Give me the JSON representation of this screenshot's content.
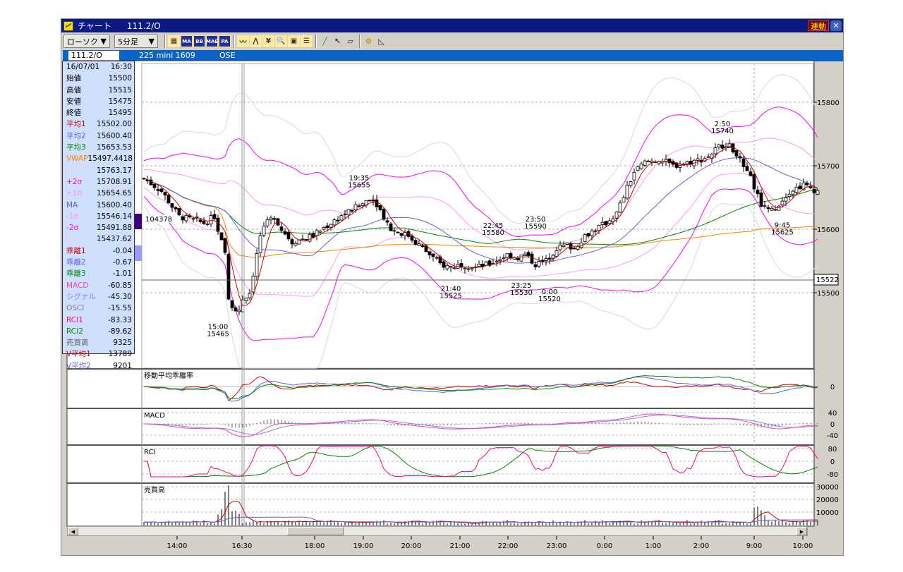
{
  "window": {
    "title": "チャート",
    "symbol": "111.2/O",
    "link_button": "連動",
    "close": "✕"
  },
  "toolbar": {
    "chart_type": "ローソク",
    "interval": "5分足",
    "arrow": "▼",
    "buttons": [
      "layout",
      "MA",
      "BB",
      "MAE",
      "PA",
      "line-chart",
      "fibonacci",
      "yen-convert",
      "zoom",
      "kanji-indicator",
      "table",
      "pen",
      "pointer",
      "eraser",
      "settings",
      "ruler"
    ]
  },
  "infobar": {
    "code": "111.2/O",
    "name": "225 mini 1609",
    "exchange": "OSE"
  },
  "info_panel": {
    "date": "16/07/01",
    "time": "16:30",
    "rows": [
      {
        "label": "始値",
        "value": "15500",
        "color": "#000000"
      },
      {
        "label": "高値",
        "value": "15515",
        "color": "#000000"
      },
      {
        "label": "安値",
        "value": "15475",
        "color": "#000000"
      },
      {
        "label": "終値",
        "value": "15495",
        "color": "#000000"
      },
      {
        "label": "平均1",
        "value": "15502.00",
        "color": "#cc0000"
      },
      {
        "label": "平均2",
        "value": "15600.40",
        "color": "#6060e0"
      },
      {
        "label": "平均3",
        "value": "15653.53",
        "color": "#008800"
      },
      {
        "label": "VWAP",
        "value": "15497.4418",
        "color": "#ff8000"
      },
      {
        "label": "+3σ",
        "value": "15763.17",
        "color": "#e0e0e0"
      },
      {
        "label": "+2σ",
        "value": "15708.91",
        "color": "#ff00ff"
      },
      {
        "label": "+1σ",
        "value": "15654.65",
        "color": "#ff90f0"
      },
      {
        "label": "MA",
        "value": "15600.40",
        "color": "#6060e0"
      },
      {
        "label": "-1σ",
        "value": "15546.14",
        "color": "#ff90f0"
      },
      {
        "label": "-2σ",
        "value": "15491.88",
        "color": "#ff00ff"
      },
      {
        "label": "-3σ",
        "value": "15437.62",
        "color": "#e0e0e0"
      },
      {
        "label": "乖離1",
        "value": "-0.04",
        "color": "#cc0000"
      },
      {
        "label": "乖離2",
        "value": "-0.67",
        "color": "#6060e0"
      },
      {
        "label": "乖離3",
        "value": "-1.01",
        "color": "#008800"
      },
      {
        "label": "MACD",
        "value": "-60.85",
        "color": "#ff40a0"
      },
      {
        "label": "シグナル",
        "value": "-45.30",
        "color": "#8080ff"
      },
      {
        "label": "OSCI",
        "value": "-15.55",
        "color": "#808080"
      },
      {
        "label": "RCI1",
        "value": "-83.33",
        "color": "#ff0080"
      },
      {
        "label": "RCI2",
        "value": "-89.62",
        "color": "#008800"
      },
      {
        "label": "売買高",
        "value": "9325",
        "color": "#606060"
      },
      {
        "label": "V平均1",
        "value": "13789",
        "color": "#cc0000"
      },
      {
        "label": "V平均2",
        "value": "9201",
        "color": "#6060e0"
      }
    ]
  },
  "chart_data": {
    "type": "candlestick",
    "y_ticks": [
      15800,
      15700,
      15600,
      15500
    ],
    "ylim": [
      15440,
      15850
    ],
    "x_ticks": [
      "14:00",
      "16:30",
      "18:00",
      "19:00",
      "20:00",
      "21:00",
      "22:00",
      "23:00",
      "0:00",
      "1:00",
      "2:00",
      "9:00",
      "10:00"
    ],
    "crosshair_price": "15522",
    "volume_marker": "104378",
    "price_path": [
      [
        0,
        15680
      ],
      [
        5,
        15660
      ],
      [
        10,
        15620
      ],
      [
        17,
        15610
      ],
      [
        20,
        15620
      ],
      [
        21,
        15600
      ],
      [
        23,
        15560
      ],
      [
        24,
        15490
      ],
      [
        25,
        15480
      ],
      [
        27,
        15470
      ],
      [
        28,
        15490
      ],
      [
        30,
        15500
      ],
      [
        31,
        15530
      ],
      [
        33,
        15590
      ],
      [
        35,
        15610
      ],
      [
        37,
        15620
      ],
      [
        39,
        15600
      ],
      [
        42,
        15580
      ],
      [
        48,
        15590
      ],
      [
        53,
        15610
      ],
      [
        57,
        15625
      ],
      [
        62,
        15640
      ],
      [
        64,
        15650
      ],
      [
        66,
        15640
      ],
      [
        68,
        15620
      ],
      [
        70,
        15600
      ],
      [
        75,
        15590
      ],
      [
        80,
        15565
      ],
      [
        84,
        15545
      ],
      [
        87,
        15540
      ],
      [
        90,
        15545
      ],
      [
        94,
        15540
      ],
      [
        98,
        15545
      ],
      [
        103,
        15560
      ],
      [
        106,
        15555
      ],
      [
        108,
        15560
      ],
      [
        111,
        15545
      ],
      [
        114,
        15550
      ],
      [
        117,
        15570
      ],
      [
        120,
        15575
      ],
      [
        122,
        15570
      ],
      [
        125,
        15590
      ],
      [
        128,
        15600
      ],
      [
        131,
        15610
      ],
      [
        134,
        15625
      ],
      [
        137,
        15665
      ],
      [
        139,
        15690
      ],
      [
        142,
        15705
      ],
      [
        146,
        15710
      ],
      [
        150,
        15700
      ],
      [
        154,
        15705
      ],
      [
        158,
        15710
      ],
      [
        160,
        15715
      ],
      [
        163,
        15730
      ],
      [
        165,
        15735
      ],
      [
        168,
        15720
      ],
      [
        170,
        15695
      ],
      [
        172,
        15680
      ],
      [
        175,
        15640
      ],
      [
        178,
        15630
      ],
      [
        180,
        15640
      ],
      [
        183,
        15660
      ],
      [
        187,
        15670
      ],
      [
        191,
        15660
      ]
    ],
    "annotations": [
      {
        "bar": 21,
        "time": "15:00",
        "price": "15465",
        "pos": "below"
      },
      {
        "bar": 61,
        "time": "19:35",
        "price": "15655",
        "pos": "above"
      },
      {
        "bar": 87,
        "time": "21:40",
        "price": "15525",
        "pos": "below"
      },
      {
        "bar": 99,
        "time": "22:45",
        "price": "15580",
        "pos": "above"
      },
      {
        "bar": 107,
        "time": "23:25",
        "price": "15530",
        "pos": "below"
      },
      {
        "bar": 111,
        "time": "23:50",
        "price": "15590",
        "pos": "above"
      },
      {
        "bar": 115,
        "time": "0:00",
        "price": "15520",
        "pos": "below"
      },
      {
        "bar": 164,
        "time": "2:50",
        "price": "15740",
        "pos": "above"
      },
      {
        "bar": 181,
        "time": "9:45",
        "price": "15625",
        "pos": "below"
      }
    ],
    "subpanels": [
      {
        "title": "移動平均乖離率",
        "ticks": [
          "0"
        ]
      },
      {
        "title": "MACD",
        "ticks": [
          "40",
          "0",
          "-40"
        ]
      },
      {
        "title": "RCI",
        "ticks": [
          "80",
          "0",
          "-80"
        ]
      },
      {
        "title": "売買高",
        "ticks": [
          "30000",
          "20000",
          "10000"
        ]
      }
    ],
    "series_colors": {
      "ma1": "#cc0000",
      "ma2": "#6060e0",
      "ma3": "#008800",
      "vwap": "#ff8000",
      "sigma3": "#d8d8d8",
      "sigma2": "#ff00ff",
      "sigma1": "#ff99ee",
      "macd": "#ff40a0",
      "signal": "#8080ff",
      "rci1": "#ff0080",
      "rci2": "#008800"
    }
  }
}
